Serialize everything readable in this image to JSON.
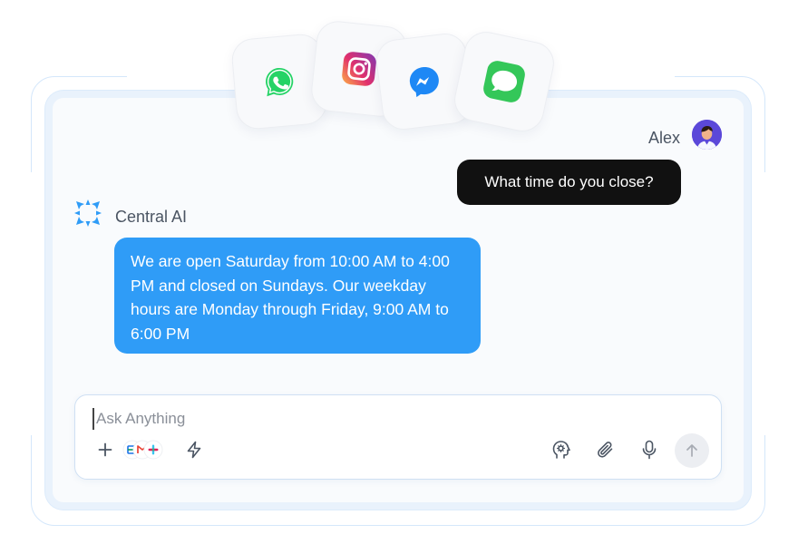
{
  "apps": [
    {
      "name": "WhatsApp",
      "icon": "whatsapp-icon",
      "color": "#25d366"
    },
    {
      "name": "Instagram",
      "icon": "instagram-icon",
      "color": "#e1306c"
    },
    {
      "name": "Messenger",
      "icon": "messenger-icon",
      "color": "#1e88f5"
    },
    {
      "name": "Messages",
      "icon": "messages-icon",
      "color": "#34c759"
    }
  ],
  "user": {
    "name": "Alex",
    "message": "What time do you close?"
  },
  "assistant": {
    "name": "Central AI",
    "message": "We are open Saturday from 10:00 AM to 4:00 PM and closed on Sundays. Our weekday hours are Monday through Friday, 9:00 AM to 6:00 PM"
  },
  "composer": {
    "placeholder": "Ask Anything",
    "tools": [
      "plus-icon",
      "integrations-icon",
      "lightning-icon",
      "brain-icon",
      "paperclip-icon",
      "microphone-icon",
      "send-arrow-icon"
    ]
  },
  "colors": {
    "accent": "#2f9cf7",
    "user_bubble": "#111111",
    "frame": "#d4e7fb"
  }
}
